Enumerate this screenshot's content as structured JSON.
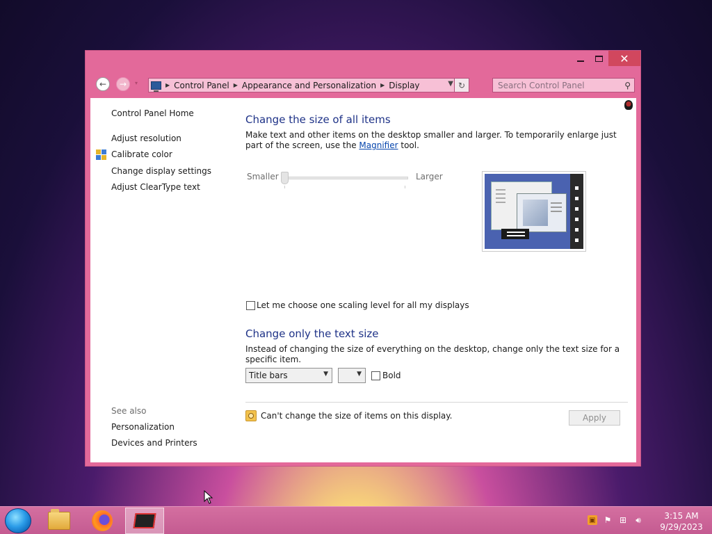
{
  "window": {
    "controls": {
      "minimize": "—",
      "maximize": "□",
      "close": "✕"
    },
    "address": {
      "breadcrumbs": [
        "Control Panel",
        "Appearance and Personalization",
        "Display"
      ]
    },
    "search": {
      "placeholder": "Search Control Panel"
    }
  },
  "sidebar": {
    "home": "Control Panel Home",
    "links": [
      "Adjust resolution",
      "Calibrate color",
      "Change display settings",
      "Adjust ClearType text"
    ],
    "see_also_label": "See also",
    "see_also": [
      "Personalization",
      "Devices and Printers"
    ]
  },
  "main": {
    "section1": {
      "title": "Change the size of all items",
      "desc_before": "Make text and other items on the desktop smaller and larger. To temporarily enlarge just part of the screen, use the ",
      "link": "Magnifier",
      "desc_after": " tool.",
      "slider_min": "Smaller",
      "slider_max": "Larger",
      "slider_value": 0
    },
    "scaling_checkbox": {
      "label": "Let me choose one scaling level for all my displays",
      "checked": false
    },
    "section2": {
      "title": "Change only the text size",
      "desc": "Instead of changing the size of everything on the desktop, change only the text size for a specific item.",
      "item_select": "Title bars",
      "size_select": "",
      "bold_label": "Bold",
      "bold_checked": false
    },
    "footer": {
      "message": "Can't change the size of items on this display.",
      "apply": "Apply"
    }
  },
  "taskbar": {
    "items": [
      "start-orb",
      "file-explorer",
      "firefox",
      "control-panel"
    ],
    "clock_time": "3:15 AM",
    "clock_date": "9/29/2023"
  },
  "colors": {
    "window_frame": "#e3699a",
    "heading": "#1e3287",
    "taskbar": "#c45b91",
    "close_button": "#d1475e"
  }
}
